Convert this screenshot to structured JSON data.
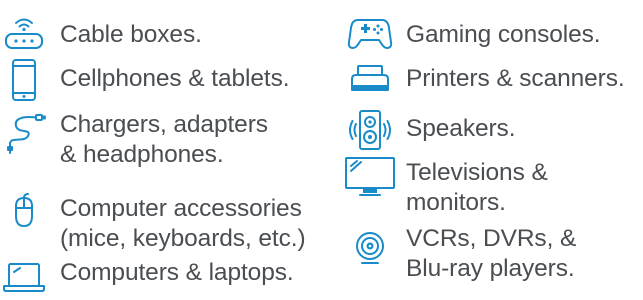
{
  "items": [
    {
      "icon": "cable-box-icon",
      "lines": [
        "Cable boxes."
      ]
    },
    {
      "icon": "cellphone-icon",
      "lines": [
        "Cellphones & tablets."
      ]
    },
    {
      "icon": "charger-cable-icon",
      "lines": [
        "Chargers, adapters",
        "& headphones."
      ]
    },
    {
      "icon": "computer-mouse-icon",
      "lines": [
        "Computer accessories",
        "(mice, keyboards, etc.)"
      ]
    },
    {
      "icon": "laptop-icon",
      "lines": [
        "Computers & laptops."
      ]
    },
    {
      "icon": "gamepad-icon",
      "lines": [
        "Gaming consoles."
      ]
    },
    {
      "icon": "printer-icon",
      "lines": [
        "Printers & scanners."
      ]
    },
    {
      "icon": "speaker-icon",
      "lines": [
        "Speakers."
      ]
    },
    {
      "icon": "television-icon",
      "lines": [
        "Televisions &",
        "monitors."
      ]
    },
    {
      "icon": "disc-icon",
      "lines": [
        "VCRs, DVRs, &",
        "Blu-ray players."
      ]
    }
  ],
  "colors": {
    "icon": "#1a8bc9",
    "text": "#4a4e52"
  }
}
